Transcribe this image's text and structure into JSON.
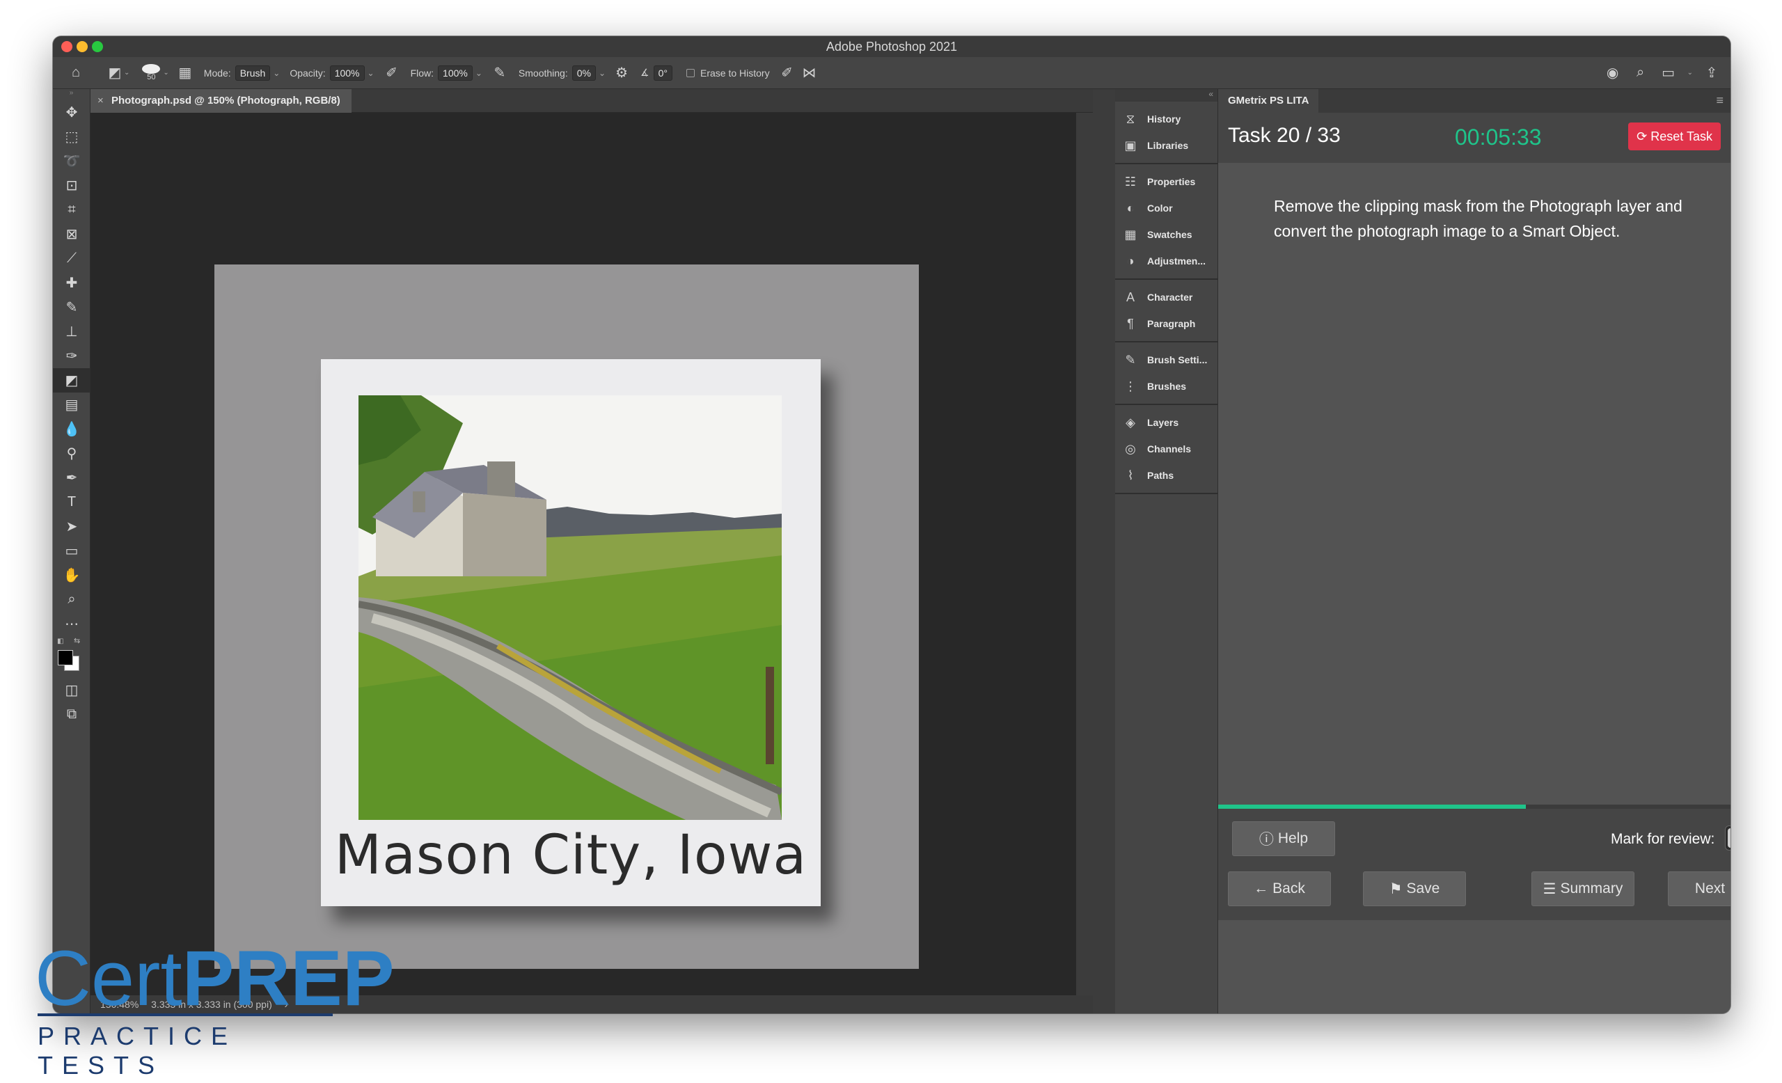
{
  "window": {
    "title": "Adobe Photoshop 2021"
  },
  "options_bar": {
    "brush_size": "50",
    "mode_label": "Mode:",
    "mode_value": "Brush",
    "opacity_label": "Opacity:",
    "opacity_value": "100%",
    "flow_label": "Flow:",
    "flow_value": "100%",
    "smoothing_label": "Smoothing:",
    "smoothing_value": "0%",
    "angle_value": "0°",
    "erase_to_history": "Erase to History"
  },
  "document": {
    "tab_title": "Photograph.psd @ 150% (Photograph, RGB/8)",
    "caption": "Mason City, Iowa",
    "status_zoom": "150.48%",
    "status_size": "3.333 in x 3.333 in (300 ppi)"
  },
  "panels": {
    "groups": [
      [
        {
          "label": "History",
          "icon": "history-icon"
        },
        {
          "label": "Libraries",
          "icon": "libraries-icon"
        }
      ],
      [
        {
          "label": "Properties",
          "icon": "properties-icon"
        },
        {
          "label": "Color",
          "icon": "color-icon"
        },
        {
          "label": "Swatches",
          "icon": "swatches-icon"
        },
        {
          "label": "Adjustmen...",
          "icon": "adjustments-icon"
        }
      ],
      [
        {
          "label": "Character",
          "icon": "character-icon"
        },
        {
          "label": "Paragraph",
          "icon": "paragraph-icon"
        }
      ],
      [
        {
          "label": "Brush Setti...",
          "icon": "brush-settings-icon"
        },
        {
          "label": "Brushes",
          "icon": "brushes-icon"
        }
      ],
      [
        {
          "label": "Layers",
          "icon": "layers-icon"
        },
        {
          "label": "Channels",
          "icon": "channels-icon"
        },
        {
          "label": "Paths",
          "icon": "paths-icon"
        }
      ]
    ]
  },
  "gmetrix": {
    "tab": "GMetrix PS LITA",
    "task_label": "Task 20 / 33",
    "timer": "00:05:33",
    "reset_label": "Reset Task",
    "instructions": "Remove the clipping mask from the Photograph layer and convert the photograph image to a Smart Object.",
    "progress": 0.6,
    "help_label": "Help",
    "mark_review_label": "Mark for review:",
    "back_label": "Back",
    "save_label": "Save",
    "summary_label": "Summary",
    "next_label": "Next",
    "accent_color": "#1fc48a",
    "reset_color": "#e0334a"
  },
  "branding": {
    "logo_cert": "Cert",
    "logo_prep": "PREP",
    "logo_sub": "PRACTICE TESTS"
  }
}
